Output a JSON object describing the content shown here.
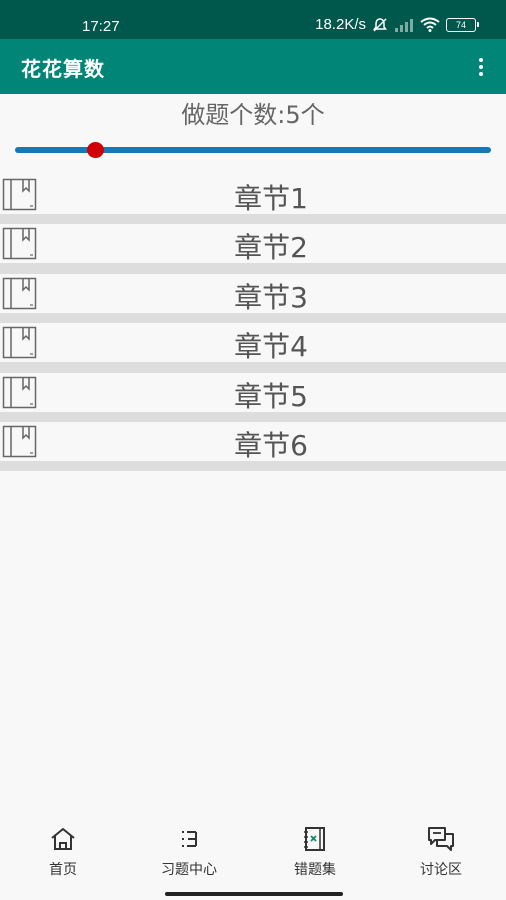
{
  "status_bar": {
    "time": "17:27",
    "net_speed": "18.2K/s",
    "battery": "74"
  },
  "app_bar": {
    "title": "花花算数",
    "overflow_icon": "more-vert-icon"
  },
  "question_count": {
    "label": "做题个数:5个",
    "slider_fraction": 0.17,
    "track_color": "#1778b8",
    "thumb_color": "#d10000"
  },
  "chapters": [
    {
      "label": "章节1",
      "icon": "book-icon"
    },
    {
      "label": "章节2",
      "icon": "book-icon"
    },
    {
      "label": "章节3",
      "icon": "book-icon"
    },
    {
      "label": "章节4",
      "icon": "book-icon"
    },
    {
      "label": "章节5",
      "icon": "book-icon"
    },
    {
      "label": "章节6",
      "icon": "book-icon"
    }
  ],
  "bottom_nav": [
    {
      "label": "首页",
      "icon": "home-icon"
    },
    {
      "label": "习题中心",
      "icon": "exercise-list-icon"
    },
    {
      "label": "错题集",
      "icon": "wrong-notebook-icon"
    },
    {
      "label": "讨论区",
      "icon": "discussion-icon"
    }
  ],
  "colors": {
    "status_bar": "#00574b",
    "app_bar": "#008577"
  }
}
